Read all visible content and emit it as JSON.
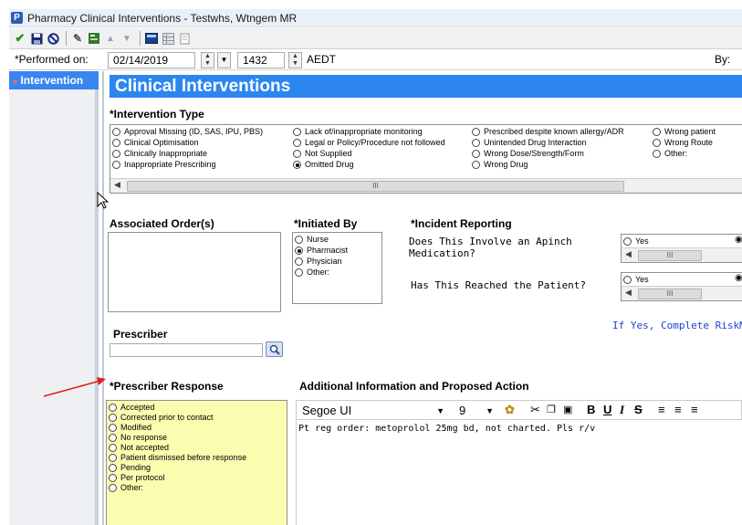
{
  "window": {
    "app_icon": "P",
    "title": "Pharmacy Clinical Interventions - Testwhs, Wtngem  MR"
  },
  "toolbar": {
    "icons": [
      "checkmark-icon",
      "save-icon",
      "cancel-icon",
      "eraser-icon",
      "form-icon",
      "arrow-up-icon",
      "arrow-down-icon",
      "calculator-icon",
      "grid-icon",
      "print-icon"
    ]
  },
  "performed": {
    "label": "*Performed on:",
    "date": "02/14/2019",
    "time": "1432",
    "timezone": "AEDT",
    "by_label": "By:"
  },
  "sidebar": {
    "tab_label": "Intervention"
  },
  "header": {
    "title": "Clinical Interventions"
  },
  "intervention_type": {
    "label": "*Intervention Type",
    "columns": [
      [
        {
          "label": "Approval Missing (ID, SAS, IPU, PBS)",
          "selected": false
        },
        {
          "label": "Clinical Optimisation",
          "selected": false
        },
        {
          "label": "Clinically Inappropriate",
          "selected": false
        },
        {
          "label": "Inappropriate Prescribing",
          "selected": false
        }
      ],
      [
        {
          "label": "Lack of/inappropriate monitoring",
          "selected": false
        },
        {
          "label": "Legal or Policy/Procedure not followed",
          "selected": false
        },
        {
          "label": "Not Supplied",
          "selected": false
        },
        {
          "label": "Omitted Drug",
          "selected": true
        }
      ],
      [
        {
          "label": "Prescribed despite known allergy/ADR",
          "selected": false
        },
        {
          "label": "Unintended Drug Interaction",
          "selected": false
        },
        {
          "label": "Wrong Dose/Strength/Form",
          "selected": false
        },
        {
          "label": "Wrong Drug",
          "selected": false
        }
      ],
      [
        {
          "label": "Wrong patient",
          "selected": false
        },
        {
          "label": "Wrong Route",
          "selected": false
        },
        {
          "label": "Other:",
          "selected": false
        }
      ]
    ]
  },
  "associated_orders": {
    "label": "Associated Order(s)"
  },
  "initiated_by": {
    "label": "*Initiated By",
    "options": [
      {
        "label": "Nurse",
        "selected": false
      },
      {
        "label": "Pharmacist",
        "selected": true
      },
      {
        "label": "Physician",
        "selected": false
      },
      {
        "label": "Other:",
        "selected": false
      }
    ]
  },
  "incident_reporting": {
    "label": "*Incident Reporting",
    "q1_line1": "Does This Involve an Apinch",
    "q1_line2": "Medication?",
    "q2": "Has This Reached the Patient?",
    "yes_label": "Yes",
    "risk_link": "If Yes, Complete RiskMa"
  },
  "prescriber": {
    "label": "Prescriber",
    "value": ""
  },
  "prescriber_response": {
    "label": "*Prescriber Response",
    "options": [
      "Accepted",
      "Corrected prior to contact",
      "Modified",
      "No response",
      "Not accepted",
      "Patient dismissed before response",
      "Pending",
      "Per protocol",
      "Other:"
    ]
  },
  "additional_info": {
    "label": "Additional Information and Proposed Action",
    "font": "Segoe UI",
    "size": "9",
    "text": "Pt reg order: metoprolol 25mg bd, not charted. Pls r/v"
  },
  "colors": {
    "header_blue": "#2d86f0",
    "highlight_yellow": "#fcfcb0",
    "annotation_arrow": "#e0201b",
    "link_blue": "#1f3fcc"
  }
}
